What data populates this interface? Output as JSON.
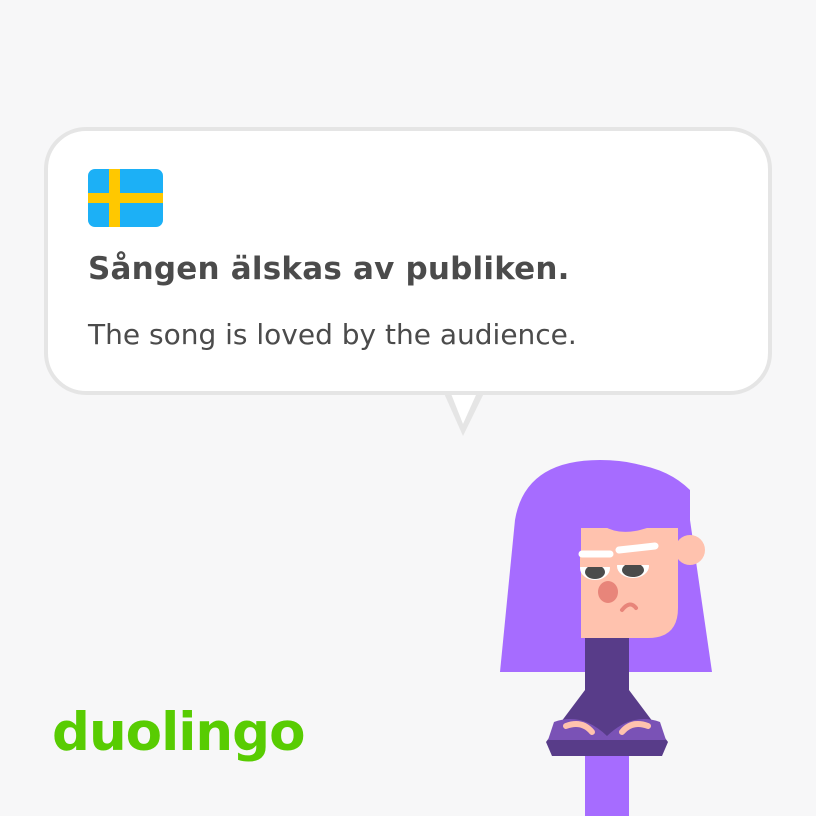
{
  "card": {
    "flag_icon": "sweden-flag-icon",
    "sentence": "Sången älskas av publiken.",
    "translation": "The song is loved by the audience."
  },
  "brand": {
    "logo_text": "duolingo",
    "logo_color": "#58cc02"
  },
  "colors": {
    "background": "#f7f7f8",
    "bubble": "#ffffff",
    "bubble_border": "#e5e5e5",
    "text": "#4b4b4b",
    "flag_blue": "#1cb0f6",
    "flag_yellow": "#ffc800",
    "hair": "#a66cff",
    "skin": "#ffc2ae",
    "sweater": "#583c89"
  },
  "character": {
    "icon": "lily-character-illustration"
  }
}
